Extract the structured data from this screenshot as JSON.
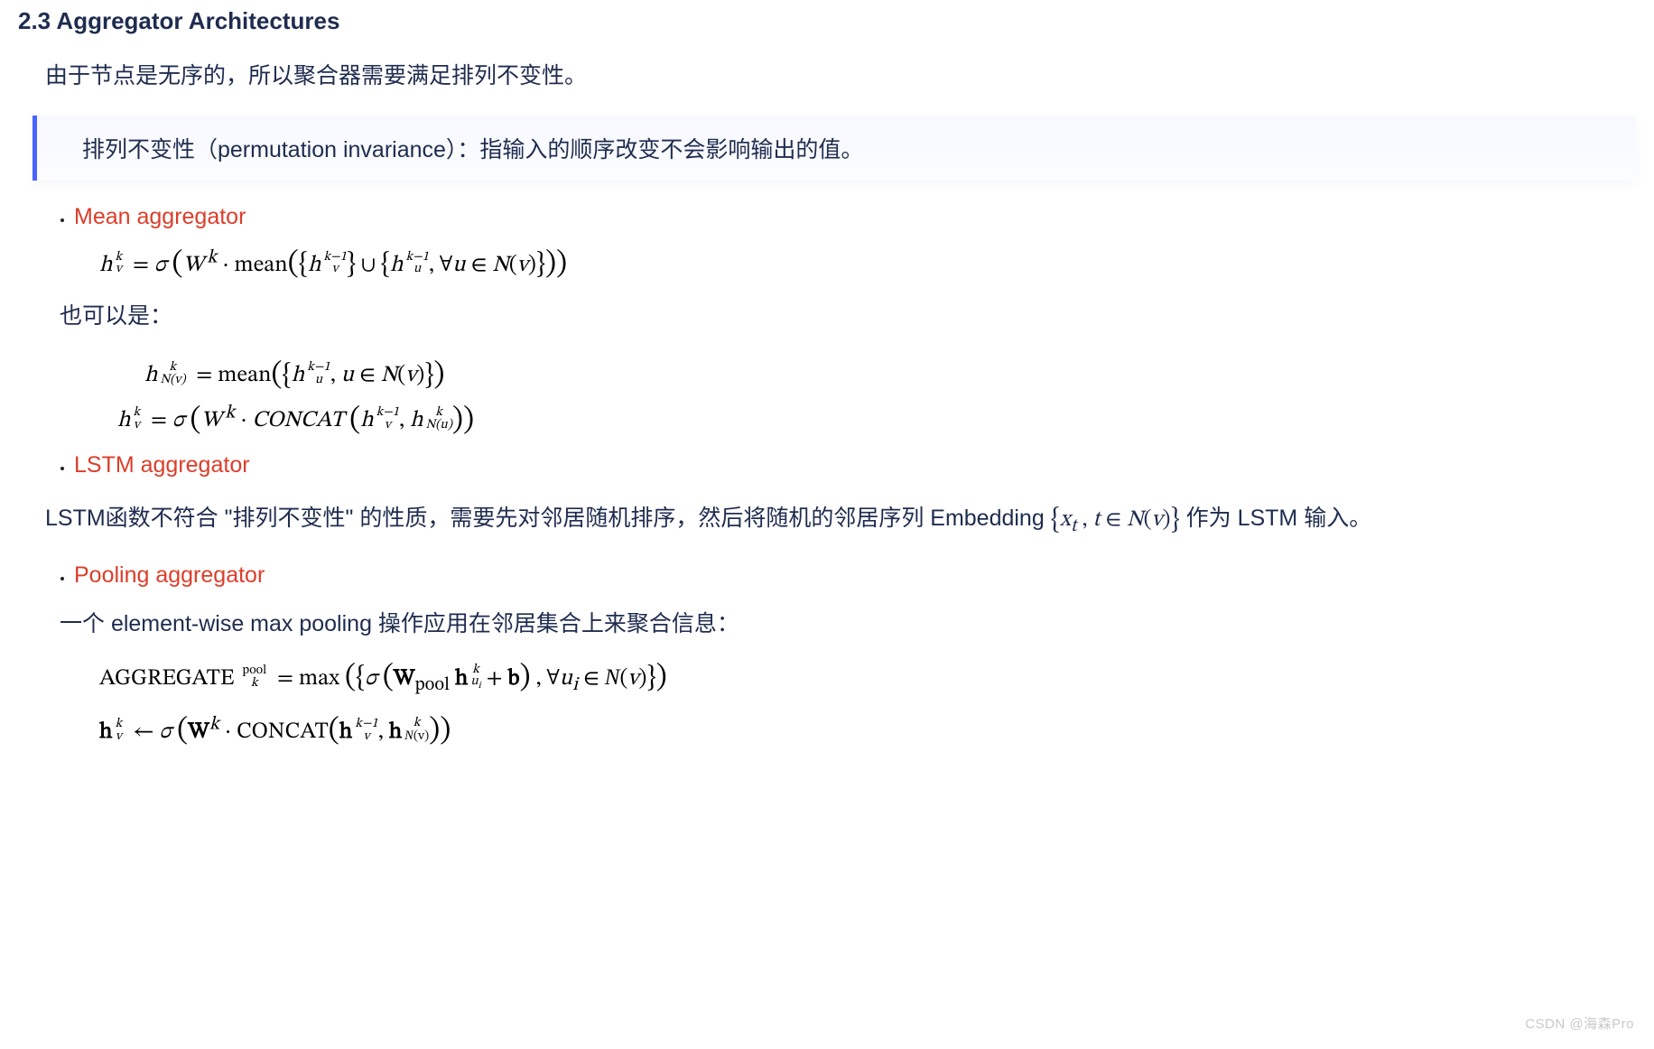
{
  "section": {
    "number": "2.3",
    "title": "Aggregator Architectures"
  },
  "intro": "由于节点是无序的，所以聚合器需要满足排列不变性。",
  "callout": "排列不变性（permutation invariance）：指输入的顺序改变不会影响输出的值。",
  "aggregators": {
    "mean": {
      "name": "Mean aggregator",
      "also_text": "也可以是：",
      "formula1_tex": "h_v^k = \\sigma\\left( W^k \\cdot \\mathrm{mean}\\left( \\{ h_v^{k-1} \\} \\cup \\{ h_u^{k-1}, \\forall u \\in N(v) \\} \\right) \\right)",
      "formula2a_tex": "h_{N(v)}^{k} = \\mathrm{mean}\\left( \\{ h_u^{k-1}, u \\in N(v) \\} \\right)",
      "formula2b_tex": "h_v^{k} = \\sigma\\left( W^{k} \\cdot \\mathit{CONCAT}\\left( h_v^{k-1}, h_{N(u)}^{k} \\right) \\right)"
    },
    "lstm": {
      "name": "LSTM aggregator",
      "desc_prefix": "LSTM函数不符合 \"排列不变性\" 的性质，需要先对邻居随机排序，然后将随机的邻居序列 Embedding ",
      "desc_set_tex": "\\{ x_t, t \\in N(v) \\}",
      "desc_suffix": " 作为 LSTM 输入。"
    },
    "pooling": {
      "name": "Pooling aggregator",
      "desc": "一个 element-wise max pooling 操作应用在邻居集合上来聚合信息：",
      "formula1_tex": "\\mathrm{AGGREGATE}\\,^{\\,pool}_{k} = \\max\\left( \\{ \\sigma\\left( \\mathbf{W}_{pool}\\,\\mathbf{h}_{u_i}^{k} + \\mathbf{b} \\right), \\forall u_i \\in \\mathcal{N}(v) \\} \\right)",
      "formula2_tex": "\\mathbf{h}_v^{k} \\leftarrow \\sigma\\left( \\mathbf{W}^{k} \\cdot \\mathrm{CONCAT}\\left( \\mathbf{h}_v^{k-1}, \\mathbf{h}_{\\mathcal{N}(v)}^{k} \\right) \\right)"
    }
  },
  "watermark": "CSDN @海森Pro"
}
